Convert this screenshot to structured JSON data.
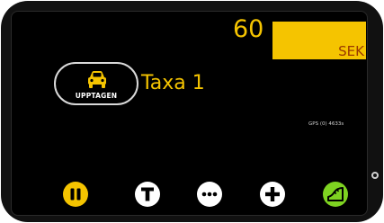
{
  "meter": {
    "count": "60",
    "currency": "SEK"
  },
  "status": {
    "label": "UPPTAGEN",
    "icon": "car-icon"
  },
  "taxi": {
    "name": "Taxa 1"
  },
  "gps": {
    "text": "GPS (0) 4633s"
  },
  "controls": [
    {
      "name": "pause-button",
      "icon": "pause-icon",
      "color": "#f5c400"
    },
    {
      "name": "tariff-button",
      "icon": "letter-t-icon",
      "color": "#ffffff"
    },
    {
      "name": "more-button",
      "icon": "more-dots-icon",
      "color": "#ffffff"
    },
    {
      "name": "add-button",
      "icon": "plus-icon",
      "color": "#ffffff"
    },
    {
      "name": "speed-button",
      "icon": "speed-ramp-icon",
      "color": "#7ed321"
    }
  ],
  "colors": {
    "accent_yellow": "#f5c400",
    "currency_text": "#9a3a00",
    "accent_green": "#7ed321",
    "screen_bg": "#000000"
  }
}
